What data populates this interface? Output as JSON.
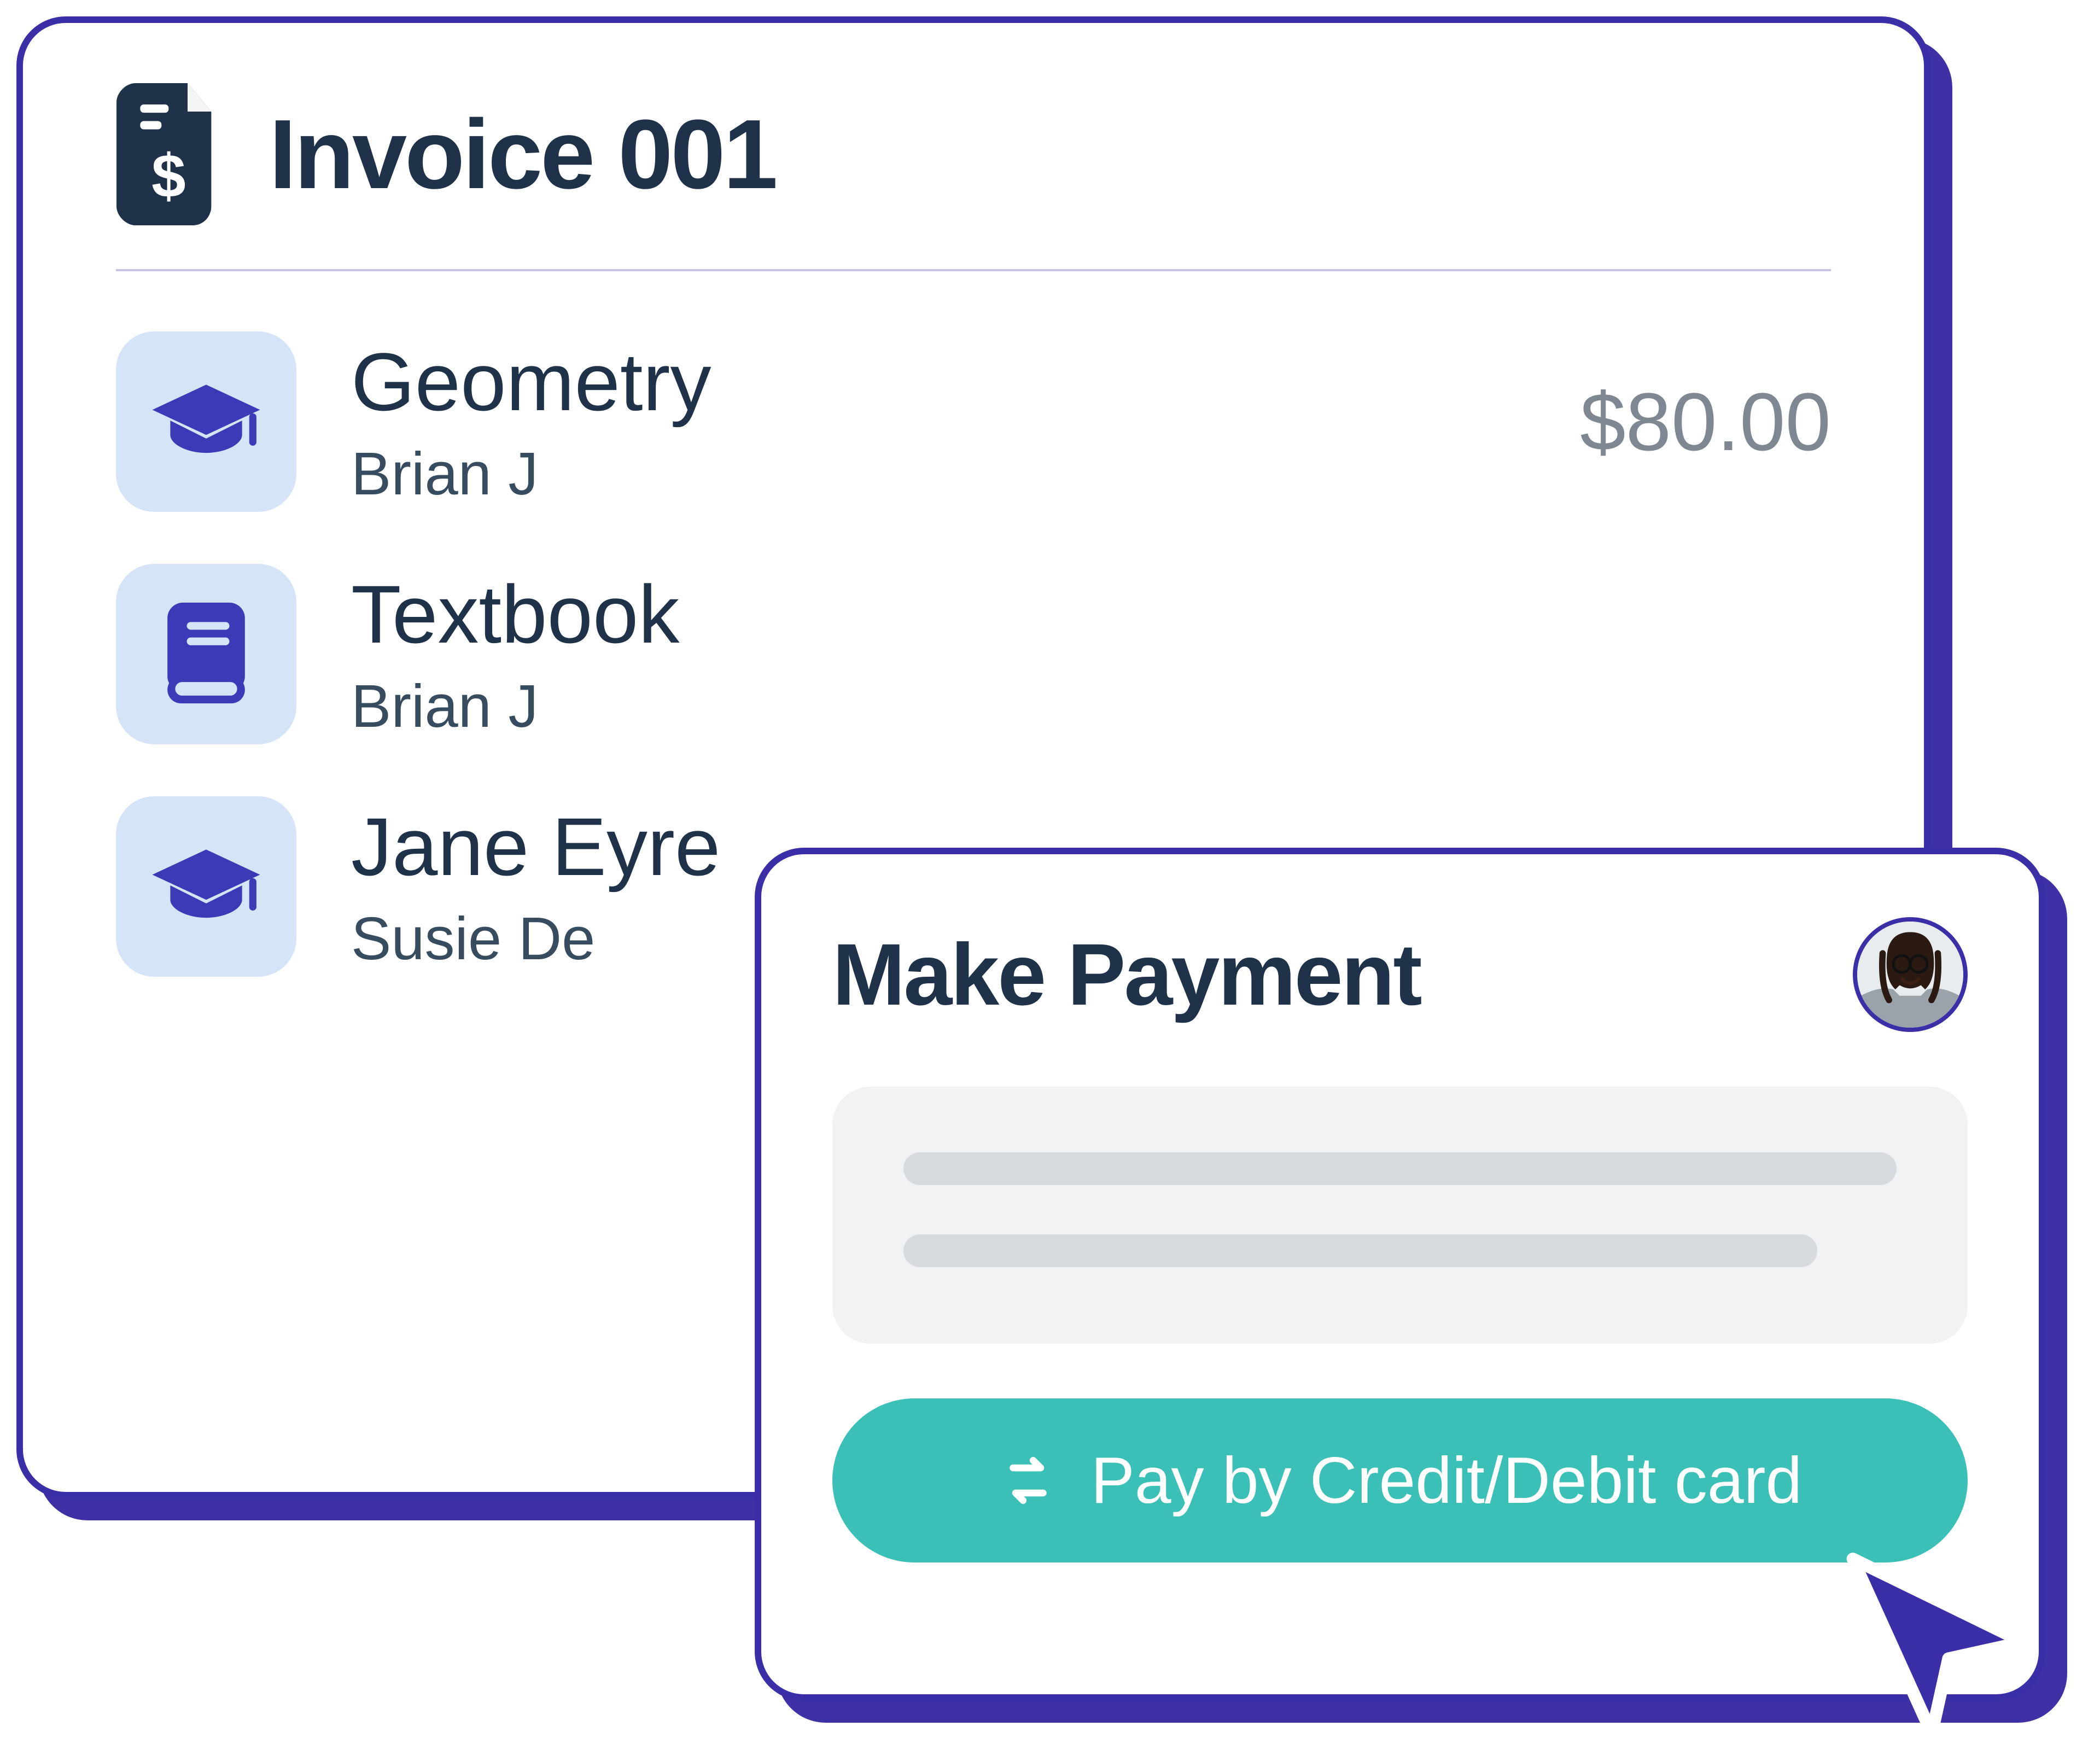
{
  "invoice": {
    "title": "Invoice 001",
    "items": [
      {
        "name": "Geometry",
        "sub": "Brian J",
        "price": "$80.00",
        "icon": "graduation-cap"
      },
      {
        "name": "Textbook",
        "sub": "Brian J",
        "price": "",
        "icon": "book"
      },
      {
        "name": "Jane Eyre",
        "sub": "Susie De",
        "price": "",
        "icon": "graduation-cap"
      }
    ]
  },
  "payment": {
    "title": "Make Payment",
    "button_label": "Pay by Credit/Debit card"
  },
  "colors": {
    "dark_navy": "#1f3249",
    "indigo": "#3b2fa8",
    "icon_blue": "#3c3ab7",
    "icon_bg": "#d6e4f8",
    "teal": "#3bc0b7",
    "price_gray": "#7f8892"
  }
}
